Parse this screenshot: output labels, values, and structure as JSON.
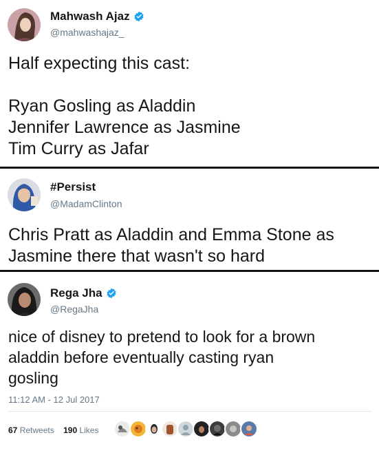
{
  "tweets": [
    {
      "name": "Mahwash Ajaz",
      "handle": "@mahwashajaz_",
      "verified": true,
      "lines": [
        "Half expecting this cast:",
        "",
        "Ryan Gosling as Aladdin",
        "Jennifer Lawrence as Jasmine",
        "Tim Curry as Jafar"
      ]
    },
    {
      "name": "#Persist",
      "handle": "@MadamClinton",
      "verified": false,
      "lines": [
        "Chris Pratt as Aladdin and Emma Stone as",
        "Jasmine there that wasn't so hard"
      ]
    },
    {
      "name": "Rega Jha",
      "handle": "@RegaJha",
      "verified": true,
      "lines": [
        "nice of disney to pretend to look for a brown",
        "aladdin before eventually casting ryan",
        "gosling"
      ],
      "timestamp": "11:12 AM - 12 Jul 2017",
      "retweets_count": "67",
      "retweets_label": "Retweets",
      "likes_count": "190",
      "likes_label": "Likes"
    }
  ],
  "colors": {
    "verified": "#1da1f2",
    "secondary_text": "#657786",
    "divider": "#111111"
  },
  "icons": [
    "verified-badge-icon"
  ]
}
